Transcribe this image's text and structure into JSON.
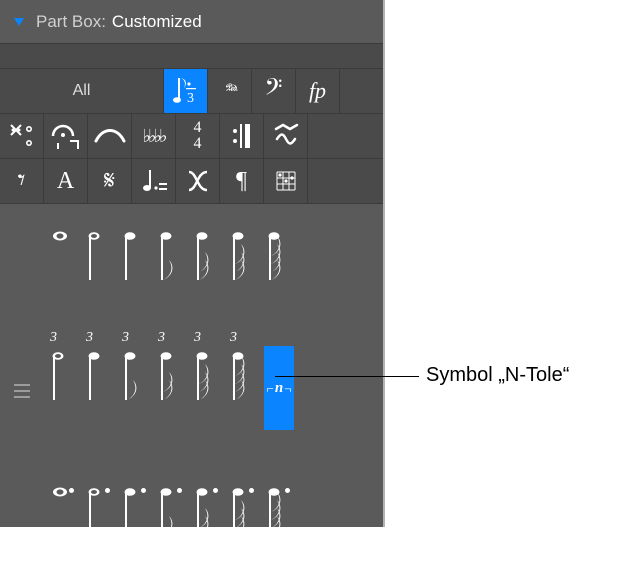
{
  "header": {
    "title": "Part Box:",
    "value": "Customized"
  },
  "toolbar": {
    "all": "All",
    "row1": [
      {
        "id": "notes",
        "glyph": "notes-triplet-icon",
        "selected": true
      },
      {
        "id": "pedal",
        "glyph": "pedal-icon"
      },
      {
        "id": "bassclef",
        "glyph": "bass-clef-icon"
      },
      {
        "id": "dynamics",
        "glyph": "forte-piano-icon"
      }
    ],
    "row2": [
      {
        "id": "repeat-jump",
        "glyph": "repeat-jump-icon"
      },
      {
        "id": "fermata-orn",
        "glyph": "fermata-ornament-icon"
      },
      {
        "id": "slur-tie",
        "glyph": "slur-icon"
      },
      {
        "id": "flats",
        "glyph": "accidentals-icon"
      },
      {
        "id": "timesig",
        "glyph": "time-sig-4-4-icon"
      },
      {
        "id": "barlines",
        "glyph": "repeat-barline-icon"
      },
      {
        "id": "trill-orn",
        "glyph": "trill-ornament-icon"
      }
    ],
    "row3": [
      {
        "id": "rests",
        "glyph": "rest-icon"
      },
      {
        "id": "text",
        "glyph": "text-A-icon"
      },
      {
        "id": "segno",
        "glyph": "segno-icon"
      },
      {
        "id": "note-eq",
        "glyph": "note-equals-icon"
      },
      {
        "id": "crossing",
        "glyph": "voice-crossing-icon"
      },
      {
        "id": "paragraph",
        "glyph": "paragraph-icon"
      },
      {
        "id": "grid",
        "glyph": "chord-grid-icon"
      }
    ]
  },
  "palette": {
    "rows": [
      {
        "kind": "plain",
        "items": [
          {
            "id": "whole"
          },
          {
            "id": "half"
          },
          {
            "id": "quarter"
          },
          {
            "id": "eighth"
          },
          {
            "id": "sixteenth"
          },
          {
            "id": "thirtysecond"
          },
          {
            "id": "sixtyfourth"
          }
        ]
      },
      {
        "kind": "triplet",
        "tuplet_label": "3",
        "items": [
          {
            "id": "t-half"
          },
          {
            "id": "t-quarter"
          },
          {
            "id": "t-eighth"
          },
          {
            "id": "t-sixteenth"
          },
          {
            "id": "t-thirtysecond"
          },
          {
            "id": "t-sixtyfourth"
          },
          {
            "id": "n-tole",
            "selected": true,
            "glyph": "n-tole"
          }
        ]
      },
      {
        "kind": "dotted",
        "items": [
          {
            "id": "d-whole"
          },
          {
            "id": "d-half"
          },
          {
            "id": "d-quarter"
          },
          {
            "id": "d-eighth"
          },
          {
            "id": "d-sixteenth"
          },
          {
            "id": "d-thirtysecond"
          },
          {
            "id": "d-sixtyfourth"
          }
        ]
      }
    ]
  },
  "callout": {
    "text": "Symbol „N-Tole“"
  },
  "ntole": {
    "label": "n"
  }
}
